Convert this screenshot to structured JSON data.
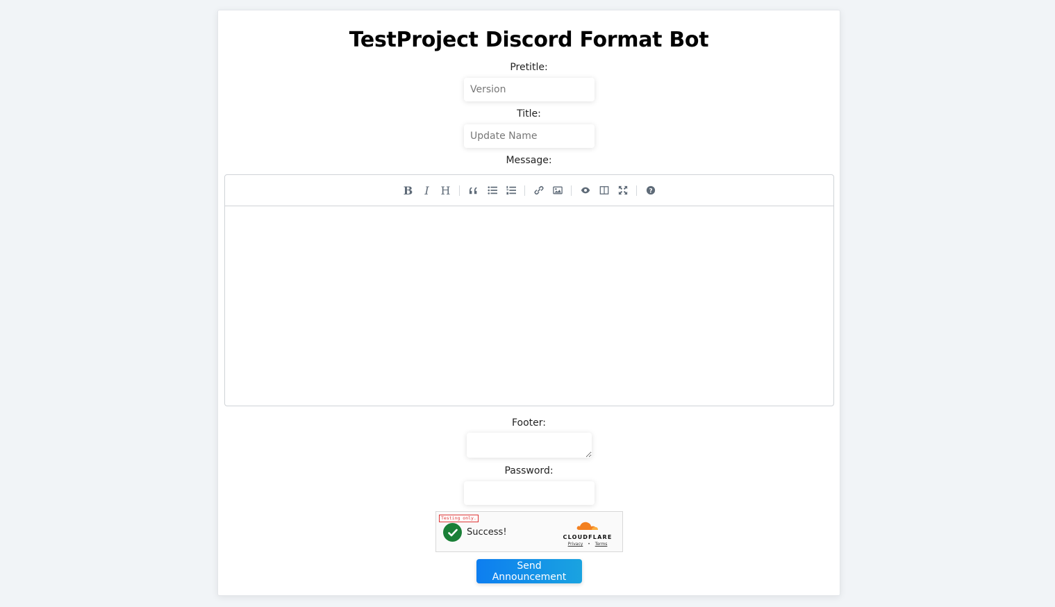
{
  "page": {
    "title": "TestProject Discord Format Bot"
  },
  "form": {
    "pretitle_label": "Pretitle:",
    "pretitle_placeholder": "Version",
    "pretitle_value": "",
    "title_label": "Title:",
    "title_placeholder": "Update Name",
    "title_value": "",
    "message_label": "Message:",
    "message_value": "",
    "footer_label": "Footer:",
    "footer_value": "",
    "password_label": "Password:",
    "password_value": "",
    "submit_label": "Send Announcement"
  },
  "editor_toolbar": {
    "bold": "B",
    "italic": "I",
    "heading": "H",
    "icons": [
      "bold-icon",
      "italic-icon",
      "heading-icon",
      "quote-icon",
      "unordered-list-icon",
      "ordered-list-icon",
      "link-icon",
      "image-icon",
      "preview-icon",
      "side-by-side-icon",
      "fullscreen-icon",
      "help-icon"
    ]
  },
  "captcha": {
    "testing_badge": "Testing only.",
    "status": "Success!",
    "provider": "CLOUDFLARE",
    "privacy": "Privacy",
    "separator": "•",
    "terms": "Terms"
  },
  "colors": {
    "background": "#f1f4f7",
    "button_gradient_start": "#0d7ef0",
    "button_gradient_end": "#1aa3e0",
    "success_green": "#1a7f37",
    "cloudflare_orange": "#f38020"
  }
}
